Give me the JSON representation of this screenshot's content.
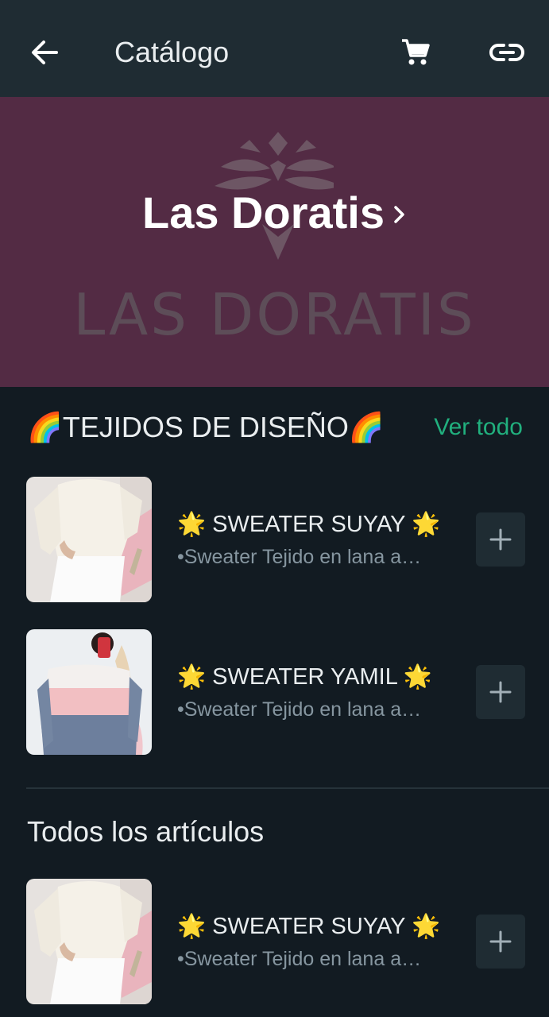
{
  "header": {
    "title": "Catálogo",
    "icons": [
      "back-arrow-icon",
      "cart-icon",
      "link-icon"
    ]
  },
  "banner": {
    "store_name": "Las Doratis",
    "watermark_text": "LAS DORATIS",
    "background_color": "#532b44"
  },
  "featured": {
    "title": "🌈TEJIDOS DE DISEÑO🌈",
    "see_all": "Ver todo",
    "items": [
      {
        "name": "🌟 SWEATER SUYAY 🌟",
        "description": "•Sweater Tejido en lana a…"
      },
      {
        "name": "🌟 SWEATER YAMIL 🌟",
        "description": "•Sweater Tejido en lana a…"
      }
    ]
  },
  "all_items": {
    "title": "Todos los artículos",
    "items": [
      {
        "name": "🌟 SWEATER SUYAY 🌟",
        "description": "•Sweater Tejido en lana a…"
      }
    ]
  },
  "colors": {
    "accent": "#21b07e",
    "bar": "#1f2c33",
    "background": "#121b22"
  }
}
